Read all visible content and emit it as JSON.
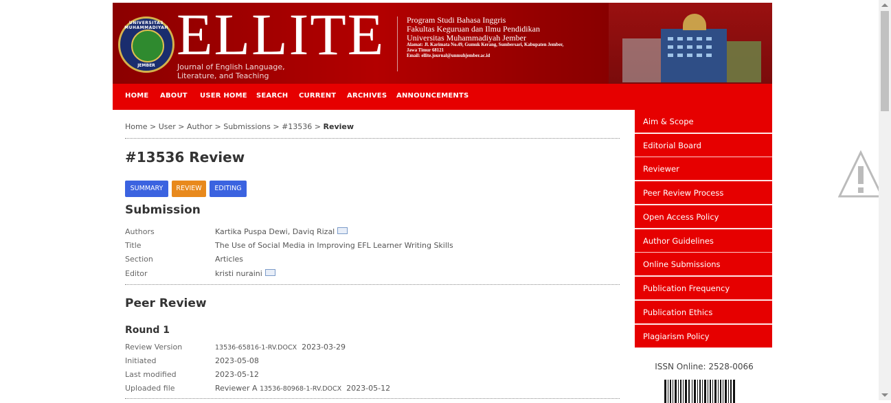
{
  "banner": {
    "title": "ELLITE",
    "subtitle_line1": "Journal of English Language,",
    "subtitle_line2": "Literature, and Teaching",
    "logo_top": "UNIVERSITAS MUHAMMADIYAH",
    "logo_bottom": "JEMBER",
    "info": {
      "line1": "Program Studi Bahasa Inggris",
      "line2": "Fakultas Keguruan dan Ilmu Pendidikan",
      "line3": "Universitas Muhammadiyah Jember",
      "line4": "Alamat: Jl. Karimata No.49, Gumuk Kerang, Sumbersari, Kabupaten Jember,",
      "line5": "Jawa Timur 68121",
      "line6": "Email: ellite.journal@unmuhjember.ac.id"
    }
  },
  "nav": {
    "items": [
      "HOME",
      "ABOUT",
      "USER HOME",
      "SEARCH",
      "CURRENT",
      "ARCHIVES",
      "ANNOUNCEMENTS"
    ]
  },
  "breadcrumb": {
    "trail": "Home > User > Author > Submissions > #13536 >",
    "current": "Review"
  },
  "page_title": "#13536 Review",
  "tabs": [
    {
      "label": "SUMMARY",
      "color": "#3b63e0"
    },
    {
      "label": "REVIEW",
      "color": "#e8891c"
    },
    {
      "label": "EDITING",
      "color": "#3b63e0"
    }
  ],
  "submission": {
    "heading": "Submission",
    "rows": [
      {
        "key": "Authors",
        "value": "Kartika Puspa Dewi, Daviq Rizal"
      },
      {
        "key": "Title",
        "value": "The Use of Social Media in Improving EFL Learner Writing Skills"
      },
      {
        "key": "Section",
        "value": "Articles"
      },
      {
        "key": "Editor",
        "value": "kristi nuraini"
      }
    ]
  },
  "peer_review": {
    "heading": "Peer Review",
    "round": "Round 1",
    "rows": {
      "review_version_key": "Review Version",
      "review_version_file": "13536-65816-1-RV.DOCX",
      "review_version_date": "2023-03-29",
      "initiated_key": "Initiated",
      "initiated_value": "2023-05-08",
      "last_modified_key": "Last modified",
      "last_modified_value": "2023-05-12",
      "uploaded_key": "Uploaded file",
      "uploaded_prefix": "Reviewer A",
      "uploaded_file": "13536-80968-1-RV.DOCX",
      "uploaded_date": "2023-05-12"
    }
  },
  "sidebar": {
    "items": [
      "Aim & Scope",
      "Editorial Board",
      "Reviewer",
      "Peer Review Process",
      "Open Access Policy",
      "Author Guidelines",
      "Online Submissions",
      "Publication Frequency",
      "Publication Ethics",
      "Plagiarism Policy"
    ],
    "issn": "ISSN Online: 2528-0066"
  },
  "colors": {
    "nav_red": "#e60000",
    "banner_red": "#b30000",
    "tab_blue": "#3b63e0",
    "tab_orange": "#e8891c"
  }
}
